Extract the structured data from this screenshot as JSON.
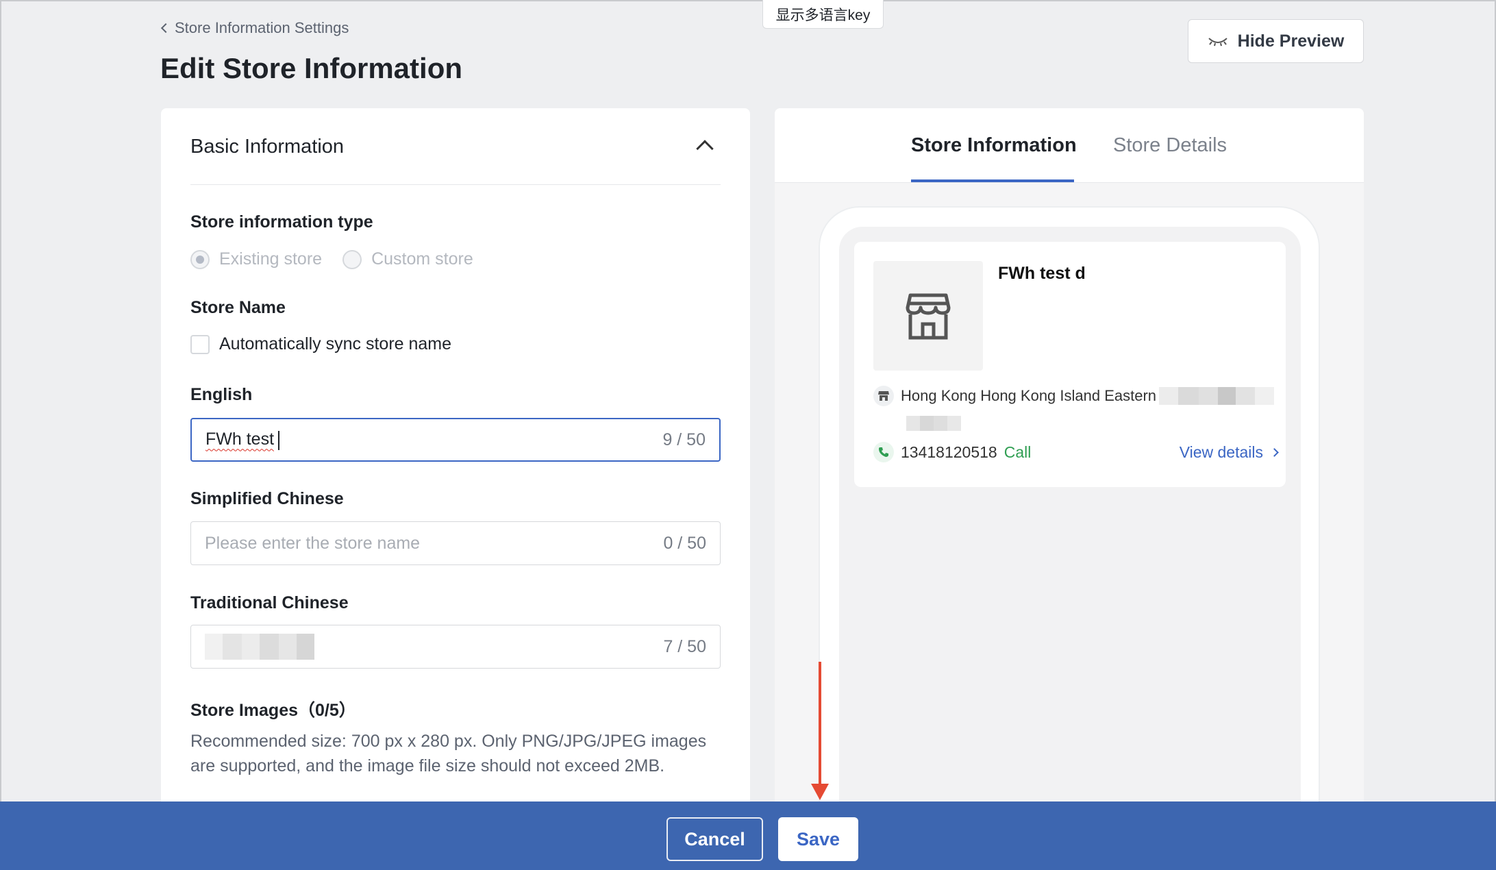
{
  "header": {
    "lang_key_label": "显示多语言key",
    "breadcrumb": "Store Information Settings",
    "title": "Edit Store Information",
    "hide_preview_label": "Hide Preview"
  },
  "form": {
    "section_title": "Basic Information",
    "store_type": {
      "label": "Store information type",
      "options": [
        "Existing store",
        "Custom store"
      ],
      "selected": "Existing store"
    },
    "store_name": {
      "label": "Store Name",
      "sync_label": "Automatically sync store name",
      "sync_checked": false
    },
    "english": {
      "label": "English",
      "value": "FWh test",
      "count": "9 / 50"
    },
    "simplified": {
      "label": "Simplified Chinese",
      "placeholder": "Please enter the store name",
      "count": "0 / 50"
    },
    "traditional": {
      "label": "Traditional Chinese",
      "count": "7 / 50"
    },
    "images": {
      "label": "Store Images（0/5）",
      "hint": "Recommended size: 700 px x 280 px. Only PNG/JPG/JPEG images are supported, and the image file size should not exceed 2MB."
    }
  },
  "preview": {
    "tabs": [
      "Store Information",
      "Store Details"
    ],
    "active_tab": "Store Information",
    "store_name": "FWh test d",
    "address": "Hong Kong Hong Kong Island Eastern",
    "phone": "13418120518",
    "call_label": "Call",
    "view_details_label": "View details"
  },
  "footer": {
    "cancel_label": "Cancel",
    "save_label": "Save"
  },
  "colors": {
    "accent": "#3b66c4",
    "footer_bg": "#3d66b0",
    "annotation_arrow": "#e54a33",
    "call_green": "#2f9e52"
  },
  "icons": [
    "chevron-left-icon",
    "eye-closed-icon",
    "chevron-up-icon",
    "store-icon",
    "shop-pin-icon",
    "phone-icon",
    "chevron-right-icon"
  ]
}
